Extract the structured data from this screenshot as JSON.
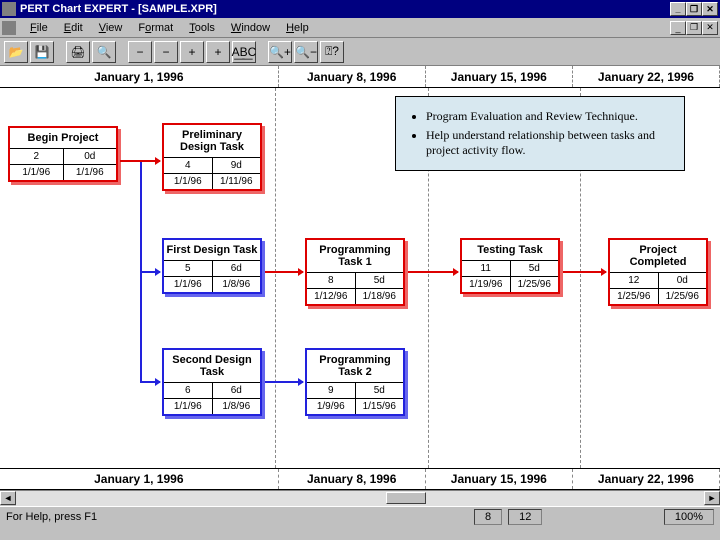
{
  "window": {
    "title": "PERT Chart EXPERT - [SAMPLE.XPR]",
    "controls": {
      "min": "_",
      "max": "❐",
      "close": "✕"
    }
  },
  "menu": {
    "file": "File",
    "edit": "Edit",
    "view": "View",
    "format": "Format",
    "tools": "Tools",
    "window": "Window",
    "help": "Help"
  },
  "toolbar": {
    "open": "📂",
    "save": "💾",
    "sep1": "|",
    "print": "🖨",
    "zoom": "🔍",
    "sep2": "|",
    "minus": "−",
    "minus2": "−",
    "plus": "+",
    "plus2": "+",
    "abc": "A͟B͟C",
    "sep3": "|",
    "zoomin": "🔍+",
    "zoomout": "🔍−",
    "help": "⍰?"
  },
  "timeline": {
    "d1": "January 1, 1996",
    "d2": "January 8, 1996",
    "d3": "January 15, 1996",
    "d4": "January 22, 1996"
  },
  "info": {
    "b1": "Program Evaluation and Review Technique.",
    "b2": "Help understand relationship between tasks and project activity flow."
  },
  "nodes": {
    "begin": {
      "title": "Begin Project",
      "id": "2",
      "dur": "0d",
      "s": "1/1/96",
      "e": "1/1/96"
    },
    "prelim": {
      "title": "Preliminary Design Task",
      "id": "4",
      "dur": "9d",
      "s": "1/1/96",
      "e": "1/11/96"
    },
    "first": {
      "title": "First Design Task",
      "id": "5",
      "dur": "6d",
      "s": "1/1/96",
      "e": "1/8/96"
    },
    "second": {
      "title": "Second Design Task",
      "id": "6",
      "dur": "6d",
      "s": "1/1/96",
      "e": "1/8/96"
    },
    "prog1": {
      "title": "Programming Task 1",
      "id": "8",
      "dur": "5d",
      "s": "1/12/96",
      "e": "1/18/96"
    },
    "prog2": {
      "title": "Programming Task 2",
      "id": "9",
      "dur": "5d",
      "s": "1/9/96",
      "e": "1/15/96"
    },
    "test": {
      "title": "Testing Task",
      "id": "11",
      "dur": "5d",
      "s": "1/19/96",
      "e": "1/25/96"
    },
    "done": {
      "title": "Project Completed",
      "id": "12",
      "dur": "0d",
      "s": "1/25/96",
      "e": "1/25/96"
    }
  },
  "status": {
    "help": "For Help, press F1",
    "a": "8",
    "b": "12",
    "zoom": "100%"
  }
}
